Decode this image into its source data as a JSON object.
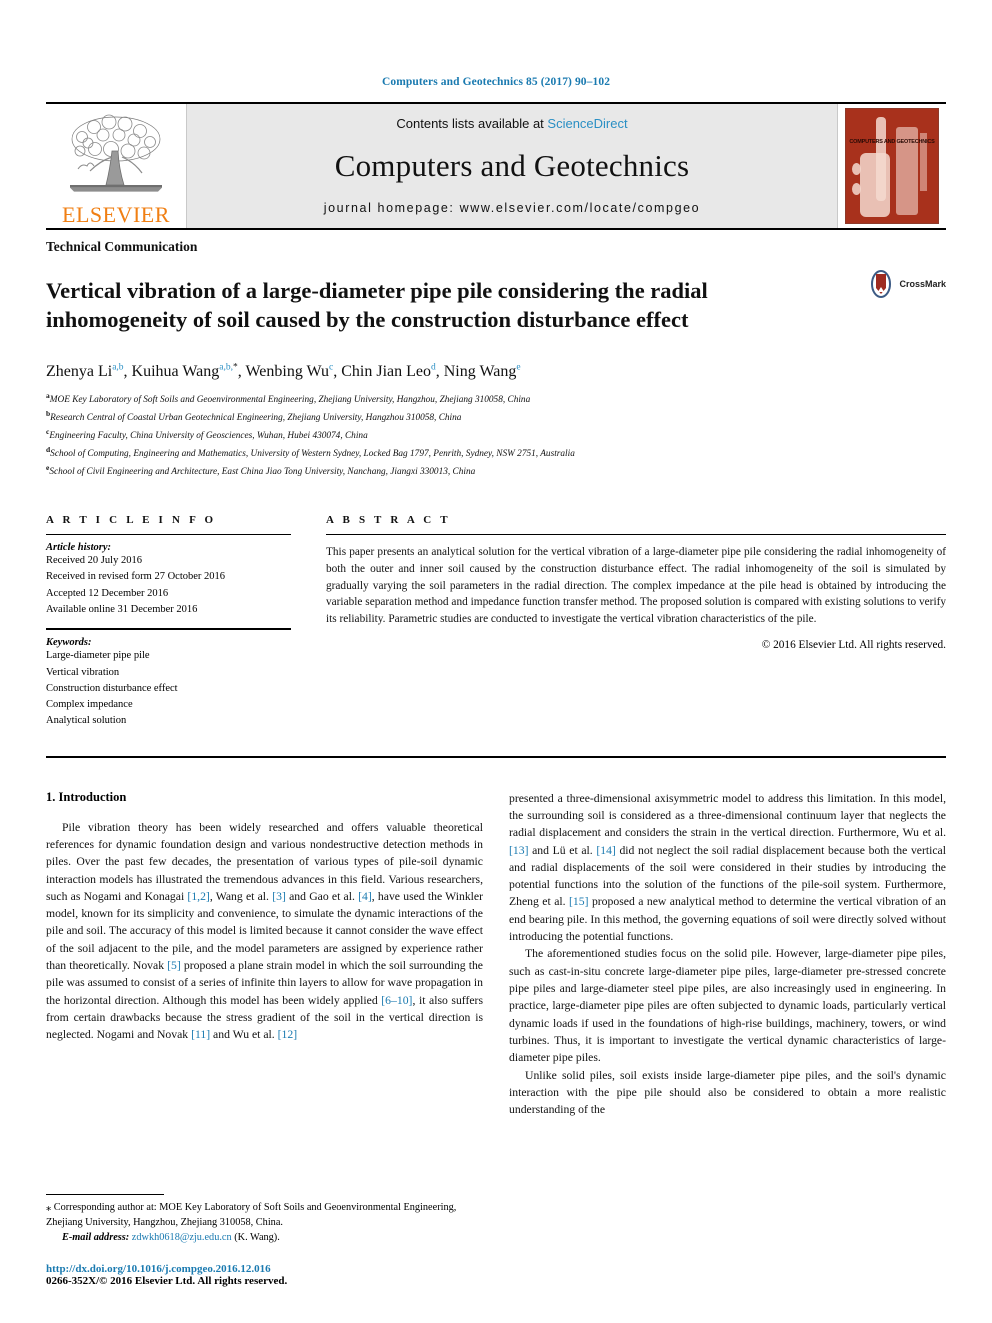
{
  "running_head": "Computers and Geotechnics 85 (2017) 90–102",
  "masthead": {
    "publisher_wordmark": "ELSEVIER",
    "contents_prefix": "Contents lists available at ",
    "contents_link": "ScienceDirect",
    "journal_name": "Computers and Geotechnics",
    "homepage": "journal homepage: www.elsevier.com/locate/compgeo",
    "cover_title": "COMPUTERS AND GEOTECHNICS",
    "colors": {
      "link_blue": "#2a8fc4",
      "elsevier_orange": "#f07f13",
      "cover_red": "#a8311c",
      "header_blue": "#1a7ab0"
    }
  },
  "article": {
    "kind": "Technical Communication",
    "title": "Vertical vibration of a large-diameter pipe pile considering the radial inhomogeneity of soil caused by the construction disturbance effect",
    "crossmark_label": "CrossMark",
    "authors": [
      {
        "name": "Zhenya Li",
        "marks": "a,b",
        "sep": ", "
      },
      {
        "name": "Kuihua Wang",
        "marks": "a,b,",
        "star": "*",
        "sep": ", "
      },
      {
        "name": "Wenbing Wu",
        "marks": "c",
        "sep": ", "
      },
      {
        "name": "Chin Jian Leo",
        "marks": "d",
        "sep": ", "
      },
      {
        "name": "Ning Wang",
        "marks": "e",
        "sep": ""
      }
    ],
    "affiliations": [
      {
        "mark": "a",
        "text": "MOE Key Laboratory of Soft Soils and Geoenvironmental Engineering, Zhejiang University, Hangzhou, Zhejiang 310058, China"
      },
      {
        "mark": "b",
        "text": "Research Central of Coastal Urban Geotechnical Engineering, Zhejiang University, Hangzhou 310058, China"
      },
      {
        "mark": "c",
        "text": "Engineering Faculty, China University of Geosciences, Wuhan, Hubei 430074, China"
      },
      {
        "mark": "d",
        "text": "School of Computing, Engineering and Mathematics, University of Western Sydney, Locked Bag 1797, Penrith, Sydney, NSW 2751, Australia"
      },
      {
        "mark": "e",
        "text": "School of Civil Engineering and Architecture, East China Jiao Tong University, Nanchang, Jiangxi 330013, China"
      }
    ]
  },
  "article_info": {
    "heading": "A R T I C L E    I N F O",
    "history_label": "Article history:",
    "history": [
      "Received 20 July 2016",
      "Received in revised form 27 October 2016",
      "Accepted 12 December 2016",
      "Available online 31 December 2016"
    ],
    "keywords_label": "Keywords:",
    "keywords": [
      "Large-diameter pipe pile",
      "Vertical vibration",
      "Construction disturbance effect",
      "Complex impedance",
      "Analytical solution"
    ]
  },
  "abstract": {
    "heading": "A B S T R A C T",
    "text": "This paper presents an analytical solution for the vertical vibration of a large-diameter pipe pile considering the radial inhomogeneity of both the outer and inner soil caused by the construction disturbance effect. The radial inhomogeneity of the soil is simulated by gradually varying the soil parameters in the radial direction. The complex impedance at the pile head is obtained by introducing the variable separation method and impedance function transfer method. The proposed solution is compared with existing solutions to verify its reliability. Parametric studies are conducted to investigate the vertical vibration characteristics of the pile.",
    "copyright": "© 2016 Elsevier Ltd. All rights reserved."
  },
  "body": {
    "section_heading": "1. Introduction",
    "left_paragraphs": [
      "Pile vibration theory has been widely researched and offers valuable theoretical references for dynamic foundation design and various nondestructive detection methods in piles. Over the past few decades, the presentation of various types of pile-soil dynamic interaction models has illustrated the tremendous advances in this field. Various researchers, such as Nogami and Konagai [1,2], Wang et al. [3] and Gao et al. [4], have used the Winkler model, known for its simplicity and convenience, to simulate the dynamic interactions of the pile and soil. The accuracy of this model is limited because it cannot consider the wave effect of the soil adjacent to the pile, and the model parameters are assigned by experience rather than theoretically. Novak [5] proposed a plane strain model in which the soil surrounding the pile was assumed to consist of a series of infinite thin layers to allow for wave propagation in the horizontal direction. Although this model has been widely applied [6–10], it also suffers from certain drawbacks because the stress gradient of the soil in the vertical direction is neglected. Nogami and Novak [11] and Wu et al. [12]"
    ],
    "right_paragraphs": [
      "presented a three-dimensional axisymmetric model to address this limitation. In this model, the surrounding soil is considered as a three-dimensional continuum layer that neglects the radial displacement and considers the strain in the vertical direction. Furthermore, Wu et al. [13] and Lü et al. [14] did not neglect the soil radial displacement because both the vertical and radial displacements of the soil were considered in their studies by introducing the potential functions into the solution of the functions of the pile-soil system. Furthermore, Zheng et al. [15] proposed a new analytical method to determine the vertical vibration of an end bearing pile. In this method, the governing equations of soil were directly solved without introducing the potential functions.",
      "The aforementioned studies focus on the solid pile. However, large-diameter pipe piles, such as cast-in-situ concrete large-diameter pipe piles, large-diameter pre-stressed concrete pipe piles and large-diameter steel pipe piles, are also increasingly used in engineering. In practice, large-diameter pipe piles are often subjected to dynamic loads, particularly vertical dynamic loads if used in the foundations of high-rise buildings, machinery, towers, or wind turbines. Thus, it is important to investigate the vertical dynamic characteristics of large-diameter pipe piles.",
      "Unlike solid piles, soil exists inside large-diameter pipe piles, and the soil's dynamic interaction with the pipe pile should also be considered to obtain a more realistic understanding of the"
    ]
  },
  "footnote": {
    "corresponding": "⁎ Corresponding author at: MOE Key Laboratory of Soft Soils and Geoenvironmental Engineering, Zhejiang University, Hangzhou, Zhejiang 310058, China.",
    "email_label": "E-mail address:",
    "email": "zdwkh0618@zju.edu.cn",
    "email_owner": "(K. Wang).",
    "doi": "http://dx.doi.org/10.1016/j.compgeo.2016.12.016",
    "issn": "0266-352X/© 2016 Elsevier Ltd. All rights reserved."
  }
}
